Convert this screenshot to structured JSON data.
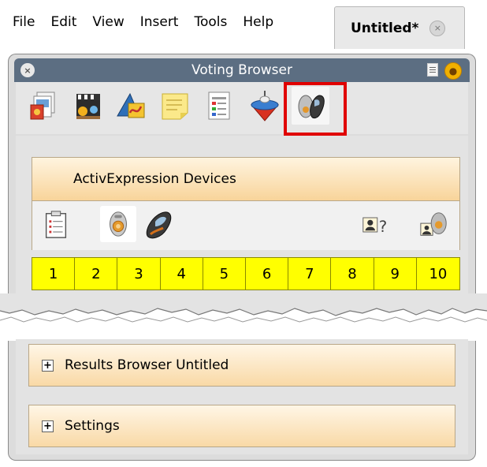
{
  "menu": {
    "items": [
      "File",
      "Edit",
      "View",
      "Insert",
      "Tools",
      "Help"
    ]
  },
  "document_tab": {
    "label": "Untitled*",
    "close_glyph": "×"
  },
  "panel": {
    "title": "Voting Browser",
    "close_glyph": "×",
    "browser_icons": [
      "resource-browser-icon",
      "page-browser-icon",
      "object-browser-icon",
      "notes-browser-icon",
      "property-browser-icon",
      "action-browser-icon",
      "voting-browser-icon"
    ],
    "selected_browser": "voting-browser-icon",
    "highlight_color": "#e00000"
  },
  "activexpression": {
    "header": "ActivExpression Devices",
    "device_icons": [
      "questions-icon",
      "activote-icon",
      "activexpression-icon",
      "identify-icon",
      "device-registration-icon"
    ],
    "numbers": [
      "1",
      "2",
      "3",
      "4",
      "5",
      "6",
      "7",
      "8",
      "9",
      "10"
    ],
    "number_bg": "#ffff00"
  },
  "sections": {
    "results_label": "Results Browser Untitled",
    "settings_label": "Settings",
    "expand_glyph": "+"
  },
  "colors": {
    "titlebar": "#5c6e82",
    "section_gradient_top": "#fff4df",
    "section_gradient_bottom": "#f8d49a"
  }
}
